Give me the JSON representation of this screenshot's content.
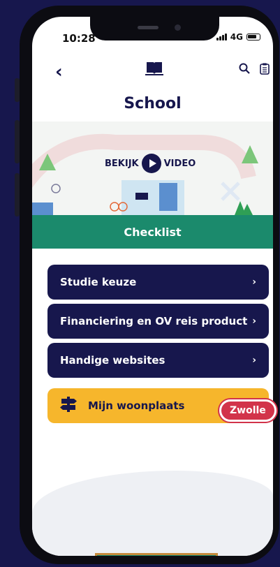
{
  "status_bar": {
    "time": "10:28",
    "network": "4G"
  },
  "header": {
    "title": "School"
  },
  "banner": {
    "watch_label": "BEKIJK",
    "video_label": "VIDEO"
  },
  "checklist": {
    "title": "Checklist"
  },
  "menu": [
    {
      "label": "Studie keuze",
      "chevron": "›"
    },
    {
      "label": "Financiering en OV reis product",
      "chevron": "›"
    },
    {
      "label": "Handige websites",
      "chevron": "›"
    }
  ],
  "location": {
    "label": "Mijn woonplaats",
    "city": "Zwolle"
  },
  "icons": [
    "back-icon",
    "book-icon",
    "search-icon",
    "clipboard-icon",
    "play-icon",
    "signpost-icon"
  ],
  "colors": {
    "navy": "#17174d",
    "green": "#1b8a6c",
    "yellow": "#f6b62c",
    "red": "#d2334a"
  }
}
